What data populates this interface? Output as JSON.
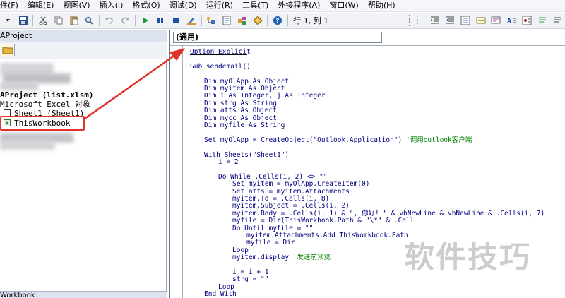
{
  "menu": [
    {
      "name": "file",
      "label": "件(F)"
    },
    {
      "name": "edit",
      "label": "编辑(E)"
    },
    {
      "name": "view",
      "label": "视图(V)"
    },
    {
      "name": "insert",
      "label": "插入(I)"
    },
    {
      "name": "format",
      "label": "格式(O)"
    },
    {
      "name": "debug",
      "label": "调试(D)"
    },
    {
      "name": "run",
      "label": "运行(R)"
    },
    {
      "name": "tools",
      "label": "工具(T)"
    },
    {
      "name": "addins",
      "label": "外接程序(A)"
    },
    {
      "name": "window",
      "label": "窗口(W)"
    },
    {
      "name": "help",
      "label": "帮助(H)"
    }
  ],
  "toolbar": {
    "position": "行 1, 列 1",
    "icons": [
      "dropdown-icon",
      "save-icon",
      "cut-icon",
      "copy-icon",
      "paste-icon",
      "find-icon",
      "undo-icon",
      "redo-icon",
      "run-icon",
      "pause-icon",
      "stop-icon",
      "design-mode-icon",
      "project-explorer-icon",
      "properties-icon",
      "object-browser-icon",
      "toolbox-icon",
      "help-icon"
    ],
    "colors": {
      "run": "#1a9a3a",
      "stop": "#1f4fa0",
      "pause": "#1f4fa0",
      "help": "#1f5fb5"
    }
  },
  "project_pane": {
    "title": "AProject",
    "tree": [
      {
        "text": "AProject (list.xlsm)",
        "bold": true
      },
      {
        "text": "Microsoft Excel 对象",
        "bold": false
      },
      {
        "text": "Sheet1 (Sheet1)",
        "bold": false
      },
      {
        "text": "ThisWorkbook",
        "bold": false
      }
    ],
    "bottom_tab": "Workbook"
  },
  "code_window": {
    "object_combo": "(通用)",
    "lines": [
      {
        "text": "Option Explicit",
        "indent": 0
      },
      {
        "text": "",
        "indent": 0
      },
      {
        "text": "Sub sendemail()",
        "indent": 0
      },
      {
        "text": "",
        "indent": 0
      },
      {
        "text": "Dim myOlApp As Object",
        "indent": 1
      },
      {
        "text": "Dim myitem As Object",
        "indent": 1
      },
      {
        "text": "Dim i As Integer, j As Integer",
        "indent": 1
      },
      {
        "text": "Dim strg As String",
        "indent": 1
      },
      {
        "text": "Dim atts As Object",
        "indent": 1
      },
      {
        "text": "Dim mycc As Object",
        "indent": 1
      },
      {
        "text": "Dim myfile As String",
        "indent": 1
      },
      {
        "text": "",
        "indent": 0
      },
      {
        "text": "Set myOlApp = CreateObject(\"Outlook.Application\") ",
        "comment": "'调用outlook客户端",
        "indent": 1
      },
      {
        "text": "",
        "indent": 0
      },
      {
        "text": "With Sheets(\"Sheet1\")",
        "indent": 1
      },
      {
        "text": "i = 2",
        "indent": 2
      },
      {
        "text": "",
        "indent": 0
      },
      {
        "text": "Do While .Cells(i, 2) <> \"\"",
        "indent": 2
      },
      {
        "text": "Set myitem = myOlApp.CreateItem(0)",
        "indent": 3
      },
      {
        "text": "Set atts = myitem.Attachments",
        "indent": 3
      },
      {
        "text": "myitem.To = .Cells(i, 8)",
        "indent": 3
      },
      {
        "text": "myitem.Subject = .Cells(i, 2)",
        "indent": 3
      },
      {
        "text": "myitem.Body = .Cells(i, 1) & \", 你好! \" & vbNewLine & vbNewLine & .Cells(i, 7)",
        "indent": 3
      },
      {
        "text": "myfile = Dir(ThisWorkbook.Path & \"\\*\" & .Cell",
        "indent": 3
      },
      {
        "text": "Do Until myfile = \"\"",
        "indent": 3
      },
      {
        "text": "myitem.Attachments.Add ThisWorkbook.Path",
        "indent": 4
      },
      {
        "text": "myfile = Dir",
        "indent": 4
      },
      {
        "text": "Loop",
        "indent": 3
      },
      {
        "text": "myitem.display ",
        "comment": "'发送前预览",
        "indent": 3
      },
      {
        "text": "",
        "indent": 0
      },
      {
        "text": "i = i + 1",
        "indent": 3
      },
      {
        "text": "strg = \"\"",
        "indent": 3
      },
      {
        "text": "Loop",
        "indent": 2
      },
      {
        "text": "End With",
        "indent": 1
      },
      {
        "text": "Set myitem = Nothing",
        "indent": 1
      }
    ]
  },
  "watermark": "软件技巧",
  "annotation_color": "#e0332c"
}
